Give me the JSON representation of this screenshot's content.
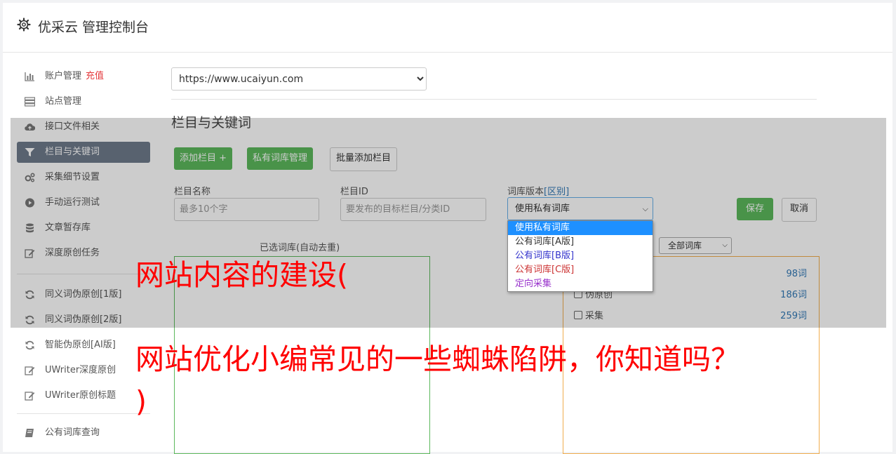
{
  "header": {
    "title": "优采云 管理控制台"
  },
  "sidebar": {
    "items": [
      {
        "label": "账户管理",
        "extra": "充值",
        "icon": "bar-chart-icon"
      },
      {
        "label": "站点管理",
        "icon": "server-icon"
      },
      {
        "label": "接口文件相关",
        "icon": "cloud-upload-icon"
      },
      {
        "label": "栏目与关键词",
        "icon": "filter-icon",
        "active": true
      },
      {
        "label": "采集细节设置",
        "icon": "gears-icon"
      },
      {
        "label": "手动运行测试",
        "icon": "play-circle-icon"
      },
      {
        "label": "文章暂存库",
        "icon": "database-icon"
      },
      {
        "label": "深度原创任务",
        "icon": "edit-icon"
      },
      {
        "label": "同义词伪原创[1版]",
        "icon": "refresh-icon"
      },
      {
        "label": "同义词伪原创[2版]",
        "icon": "refresh-icon"
      },
      {
        "label": "智能伪原创[AI版]",
        "icon": "refresh-icon"
      },
      {
        "label": "UWriter深度原创",
        "icon": "edit-icon"
      },
      {
        "label": "UWriter原创标题",
        "icon": "edit-icon"
      },
      {
        "label": "公有词库查询",
        "icon": "book-icon"
      }
    ]
  },
  "main": {
    "site_select": "https://www.ucaiyun.com",
    "section_title": "栏目与关键词",
    "buttons": {
      "add_column": "添加栏目 +",
      "private_lib": "私有词库管理",
      "batch_add": "批量添加栏目"
    },
    "form": {
      "column_name_label": "栏目名称",
      "column_name_placeholder": "最多10个字",
      "column_id_label": "栏目ID",
      "column_id_placeholder": "要发布的目标栏目/分类ID",
      "lib_version_label": "词库版本",
      "lib_version_link": "[区别]",
      "lib_version_value": "使用私有词库",
      "save": "保存",
      "cancel": "取消"
    },
    "version_options": [
      {
        "label": "使用私有词库",
        "color": "#ffffff",
        "selected": true
      },
      {
        "label": "公有词库[A版]",
        "color": "#333333"
      },
      {
        "label": "公有词库[B版]",
        "color": "#3333cc"
      },
      {
        "label": "公有词库[C版]",
        "color": "#cc3333"
      },
      {
        "label": "定向采集",
        "color": "#9933cc"
      }
    ],
    "selected_lib_title": "已选词库(自动去重)",
    "lib_filter": "全部词库",
    "lib_rows": [
      {
        "label": "",
        "count": "98词"
      },
      {
        "label": "伪原创",
        "count": "186词"
      },
      {
        "label": "采集",
        "count": "259词"
      }
    ]
  },
  "captions": {
    "line1": "网站内容的建设(",
    "line2": "网站优化小编常见的一些蜘蛛陷阱，你知道吗？",
    "line3": ")"
  }
}
